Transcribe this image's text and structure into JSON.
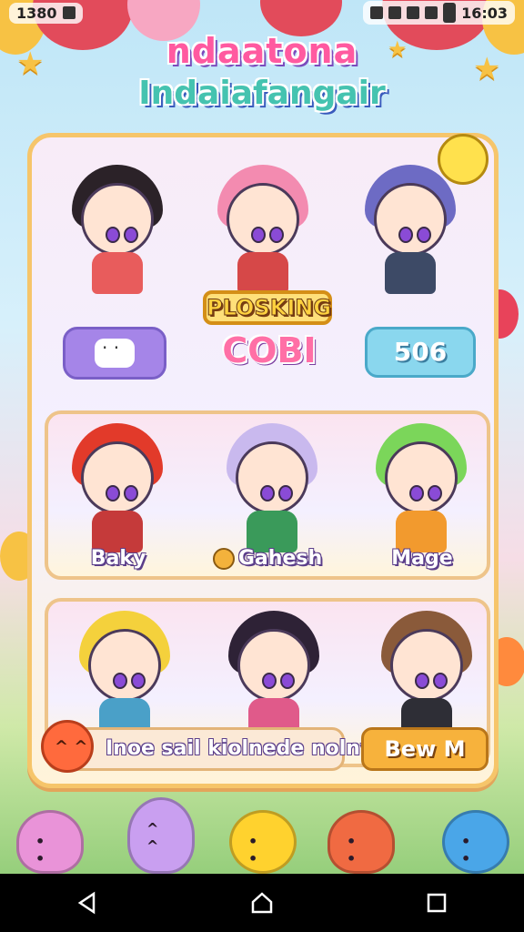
{
  "status_bar": {
    "time_left": "1380",
    "time_right": "16:03"
  },
  "title": {
    "line1": "ndaatona",
    "line2": "Indaiafangair"
  },
  "featured": {
    "banner": "PLOSKING",
    "logo": "COBI",
    "score": "506"
  },
  "characters_row2": [
    {
      "name": "Baky"
    },
    {
      "name": "Gahesh"
    },
    {
      "name": "Mage"
    }
  ],
  "action_bar": {
    "prompt": "Inoe sail kiolnede nolny",
    "button": "Bew M"
  },
  "icons": {
    "chat": "chat-bubble-icon",
    "back": "back-icon",
    "home": "home-icon",
    "recents": "recents-icon"
  },
  "colors": {
    "panel_border": "#f6c56a",
    "accent_pink": "#ff5aa0",
    "accent_teal": "#45c3b0",
    "button_orange": "#f7b23c"
  }
}
